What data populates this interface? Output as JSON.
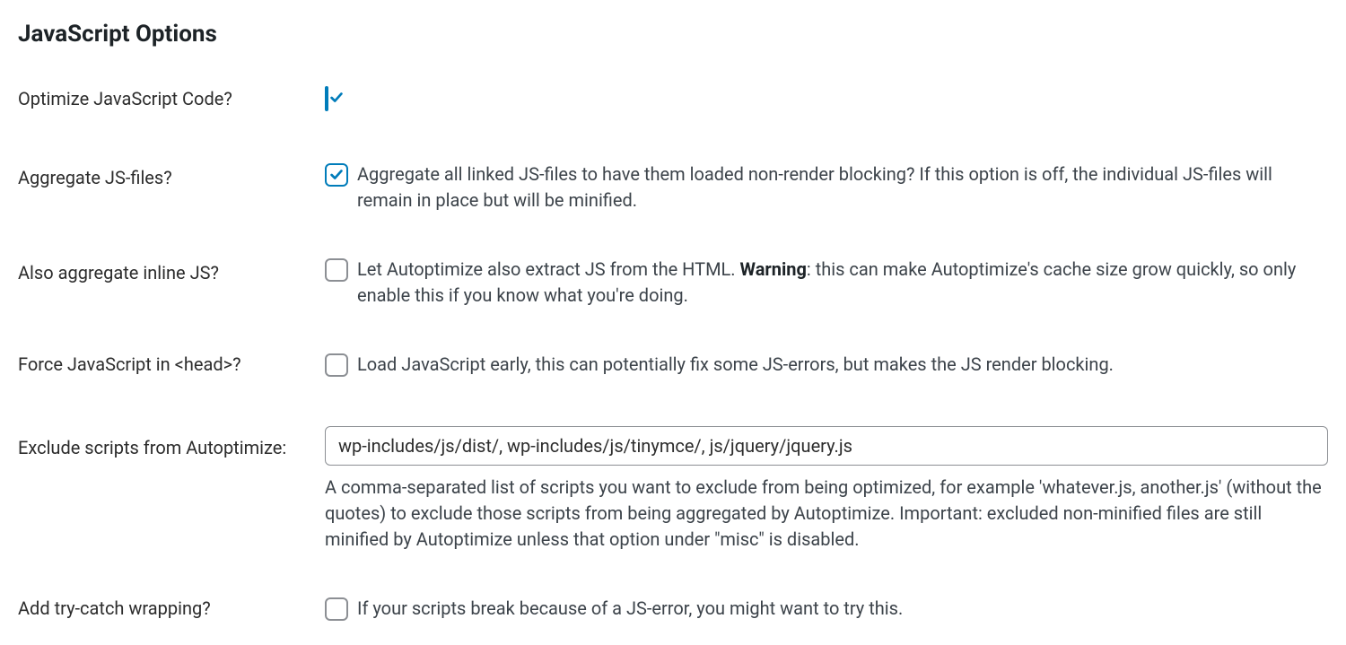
{
  "section": {
    "title": "JavaScript Options"
  },
  "options": {
    "optimize_js": {
      "label": "Optimize JavaScript Code?",
      "checked": true
    },
    "aggregate_js": {
      "label": "Aggregate JS-files?",
      "checked": true,
      "desc": "Aggregate all linked JS-files to have them loaded non-render blocking? If this option is off, the individual JS-files will remain in place but will be minified."
    },
    "aggregate_inline": {
      "label": "Also aggregate inline JS?",
      "checked": false,
      "desc_pre": "Let Autoptimize also extract JS from the HTML. ",
      "desc_strong": "Warning",
      "desc_post": ": this can make Autoptimize's cache size grow quickly, so only enable this if you know what you're doing."
    },
    "force_head": {
      "label": "Force JavaScript in <head>?",
      "checked": false,
      "desc": "Load JavaScript early, this can potentially fix some JS-errors, but makes the JS render blocking."
    },
    "exclude": {
      "label": "Exclude scripts from Autoptimize:",
      "value": "wp-includes/js/dist/, wp-includes/js/tinymce/, js/jquery/jquery.js",
      "help": "A comma-separated list of scripts you want to exclude from being optimized, for example 'whatever.js, another.js' (without the quotes) to exclude those scripts from being aggregated by Autoptimize. Important: excluded non-minified files are still minified by Autoptimize unless that option under \"misc\" is disabled."
    },
    "trycatch": {
      "label": "Add try-catch wrapping?",
      "checked": false,
      "desc": "If your scripts break because of a JS-error, you might want to try this."
    }
  }
}
